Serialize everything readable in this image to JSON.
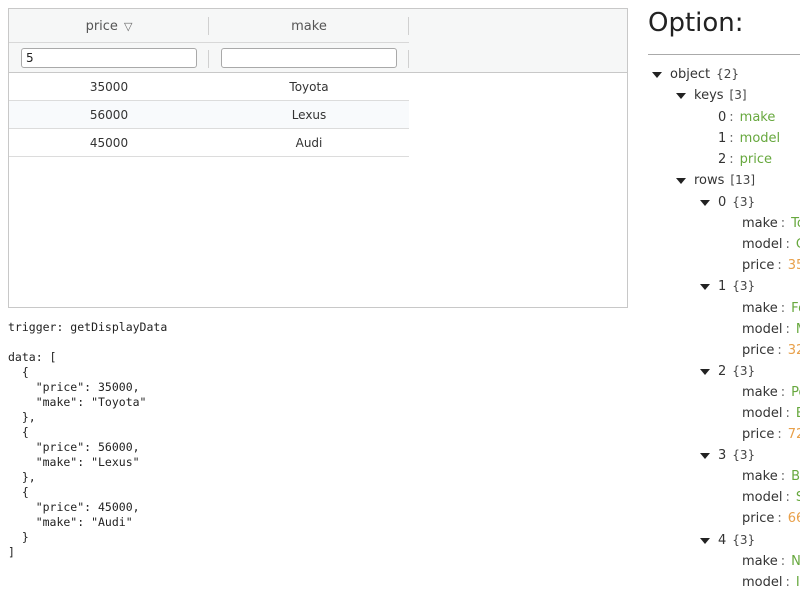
{
  "grid": {
    "columns": [
      {
        "label": "price",
        "sort_icon": "filter-triangle-icon"
      },
      {
        "label": "make"
      }
    ],
    "filters": [
      {
        "value": "5",
        "placeholder": ""
      },
      {
        "value": "",
        "placeholder": ""
      }
    ],
    "rows": [
      {
        "price": "35000",
        "make": "Toyota"
      },
      {
        "price": "56000",
        "make": "Lexus"
      },
      {
        "price": "45000",
        "make": "Audi"
      }
    ]
  },
  "output": {
    "text": "trigger: getDisplayData\n\ndata: [\n  {\n    \"price\": 35000,\n    \"make\": \"Toyota\"\n  },\n  {\n    \"price\": 56000,\n    \"make\": \"Lexus\"\n  },\n  {\n    \"price\": 45000,\n    \"make\": \"Audi\"\n  }\n]"
  },
  "option_panel": {
    "title": "Option:",
    "root": {
      "key": "object",
      "count": "{2}"
    },
    "keys": {
      "key": "keys",
      "count": "[3]",
      "items": [
        "make",
        "model",
        "price"
      ]
    },
    "rows": {
      "key": "rows",
      "count": "[13]",
      "items": [
        {
          "index": "0",
          "count": "{3}",
          "make": "To",
          "model": "C",
          "price": "35"
        },
        {
          "index": "1",
          "count": "{3}",
          "make": "Fo",
          "model": "M",
          "price": "32"
        },
        {
          "index": "2",
          "count": "{3}",
          "make": "Po",
          "model": "B",
          "price": "72"
        },
        {
          "index": "3",
          "count": "{3}",
          "make": "B",
          "model": "S",
          "price": "66"
        },
        {
          "index": "4",
          "count": "{3}",
          "make": "N",
          "model": "I",
          "price": ""
        }
      ]
    },
    "field_labels": {
      "make": "make",
      "model": "model",
      "price": "price"
    }
  }
}
